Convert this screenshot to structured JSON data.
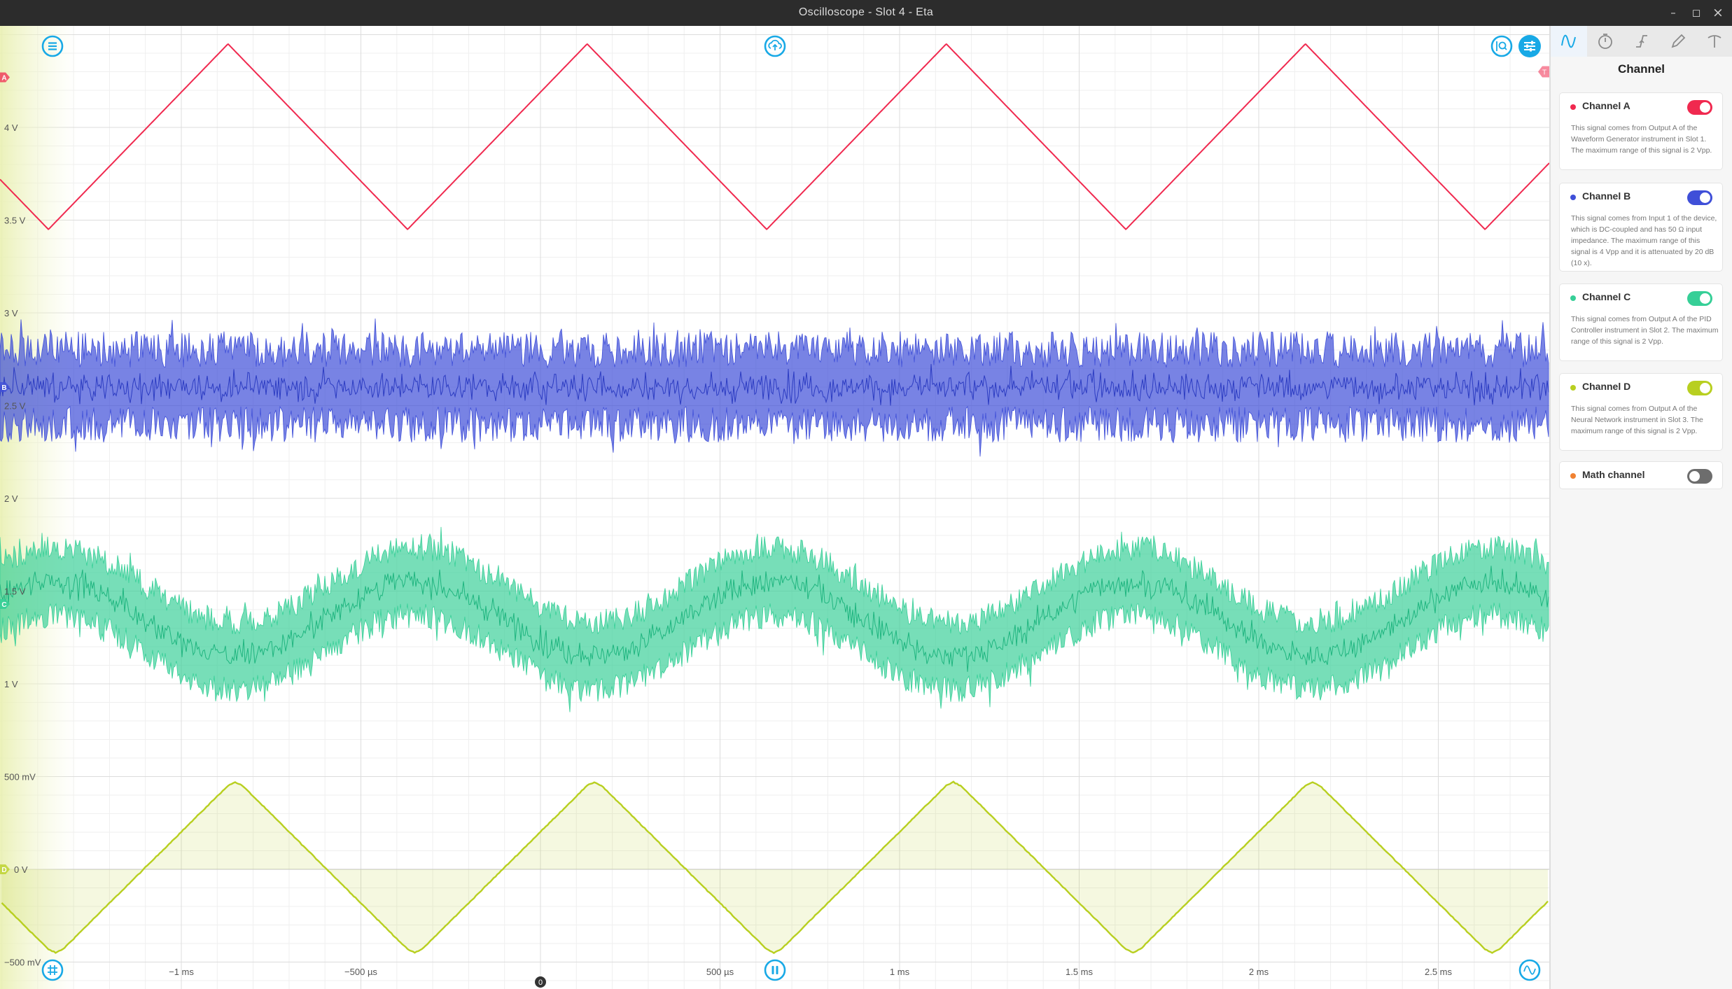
{
  "window": {
    "title": "Oscilloscope - Slot 4 - Eta",
    "controls": {
      "minimize": "–",
      "maximize": "◻",
      "close": "×"
    }
  },
  "toolbar": {
    "menu_icon": "hamburger-menu-icon",
    "upload_icon": "cloud-upload-icon",
    "zoom_icon": "zoom-fit-icon",
    "settings_icon": "sliders-icon",
    "grid_icon": "grid-icon",
    "pause_icon": "pause-icon",
    "waveform_icon": "waveform-icon"
  },
  "plot": {
    "y_labels": [
      "4 V",
      "3.5 V",
      "3 V",
      "2.5 V",
      "2 V",
      "1.5 V",
      "1 V",
      "500 mV",
      "0 V",
      "−500 mV"
    ],
    "x_labels": [
      "−1 ms",
      "−500 µs",
      "500 µs",
      "1 ms",
      "1.5 ms",
      "2 ms",
      "2.5 ms"
    ],
    "trigger_marker": "0",
    "channel_markers": [
      "A",
      "B",
      "C",
      "D"
    ],
    "trigger_level_marker": "T"
  },
  "chart_data": {
    "type": "line",
    "xlabel": "",
    "ylabel": "",
    "x_range_ms": [
      -1.5,
      2.8
    ],
    "y_range_V": [
      -0.5,
      4.9
    ],
    "grid": true,
    "series": [
      {
        "name": "Channel A",
        "shape": "triangle",
        "min_V": 3.45,
        "max_V": 4.45,
        "peaks_ms": [
          -0.87,
          0.13,
          1.13,
          2.13
        ],
        "troughs_ms": [
          -1.37,
          -0.37,
          0.63,
          1.63,
          2.63
        ]
      },
      {
        "name": "Channel B",
        "shape": "noise",
        "center_V": 2.6,
        "spread_V": 0.3
      },
      {
        "name": "Channel C",
        "shape": "noisy sine",
        "center_V": 1.35,
        "amplitude_V": 0.2,
        "period_ms": 1.0,
        "noise_V": 0.25
      },
      {
        "name": "Channel D",
        "shape": "triangle",
        "min_V": -0.47,
        "max_V": 0.49,
        "peaks_ms": [
          -0.85,
          0.15,
          1.15,
          2.15
        ],
        "troughs_ms": [
          -1.35,
          -0.35,
          0.65,
          1.65,
          2.65
        ]
      }
    ]
  },
  "panel": {
    "tabs": [
      "channel-tab-icon",
      "timebase-tab-icon",
      "trigger-tab-icon",
      "measure-tab-icon",
      "cursor-tab-icon"
    ],
    "title": "Channel",
    "channels": [
      {
        "name": "Channel A",
        "color": "#f0294f",
        "enabled": true,
        "description": "This signal comes from Output A of the Waveform Generator instrument in Slot 1. The maximum range of this signal is 2 Vpp."
      },
      {
        "name": "Channel B",
        "color": "#3f4fd8",
        "enabled": true,
        "description": "This signal comes from Input 1 of the device, which is DC-coupled and has 50 Ω input impedance. The maximum range of this signal is 4 Vpp and it is attenuated by 20 dB (10 x)."
      },
      {
        "name": "Channel C",
        "color": "#36cf97",
        "enabled": true,
        "description": "This signal comes from Output A of the PID Controller instrument in Slot 2. The maximum range of this signal is 2 Vpp."
      },
      {
        "name": "Channel D",
        "color": "#b8cf20",
        "enabled": true,
        "description": "This signal comes from Output A of the Neural Network instrument in Slot 3. The maximum range of this signal is 2 Vpp."
      },
      {
        "name": "Math channel",
        "color": "#f08232",
        "enabled": false,
        "description": ""
      }
    ]
  },
  "colors": {
    "accent": "#18a9e6",
    "channel_a": "#f0294f",
    "channel_b": "#3f4fd8",
    "channel_c": "#36cf97",
    "channel_d": "#b8cf20",
    "math": "#f08232"
  }
}
